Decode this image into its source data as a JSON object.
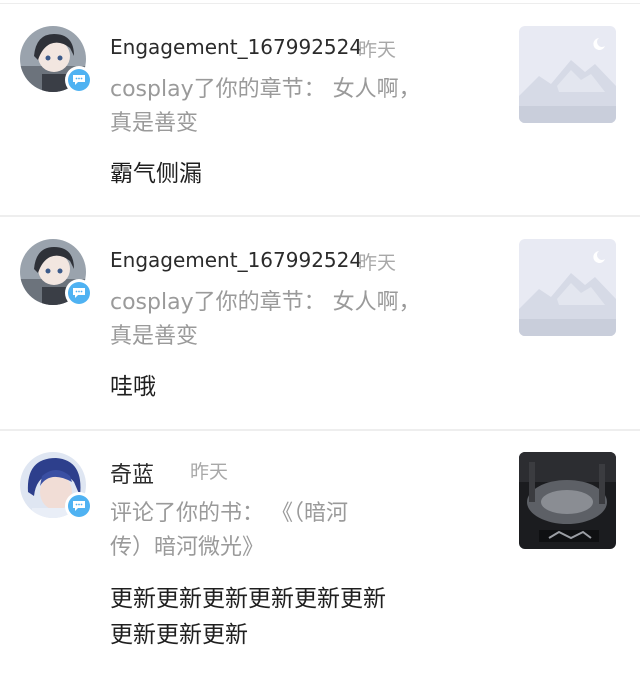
{
  "notifications": [
    {
      "user": "Engagement_167992524",
      "time": "昨天",
      "action_line1": "cosplay了你的章节： 女人啊，",
      "action_line2": "真是善变",
      "comment": "霸气侧漏",
      "avatar_icon": "anime-avatar-icon",
      "thumbnail_icon": "placeholder-mountain-icon",
      "badge_icon": "comment-bubble-icon"
    },
    {
      "user": "Engagement_167992524",
      "time": "昨天",
      "action_line1": "cosplay了你的章节： 女人啊，",
      "action_line2": "真是善变",
      "comment": "哇哦",
      "avatar_icon": "anime-avatar-icon",
      "thumbnail_icon": "placeholder-mountain-icon",
      "badge_icon": "comment-bubble-icon"
    },
    {
      "user": "奇蓝",
      "time": "昨天",
      "action_line1": "评论了你的书： 《（暗河",
      "action_line2": "传）暗河微光》",
      "comment_line1": "更新更新更新更新更新更新",
      "comment_line2": "更新更新更新",
      "avatar_icon": "blue-hair-avatar-icon",
      "thumbnail_icon": "book-cover-icon",
      "badge_icon": "comment-bubble-icon"
    }
  ],
  "colors": {
    "badge": "#4fb2f2",
    "placeholder_bg": "#e8eaf3",
    "divider": "#eeeeee"
  }
}
